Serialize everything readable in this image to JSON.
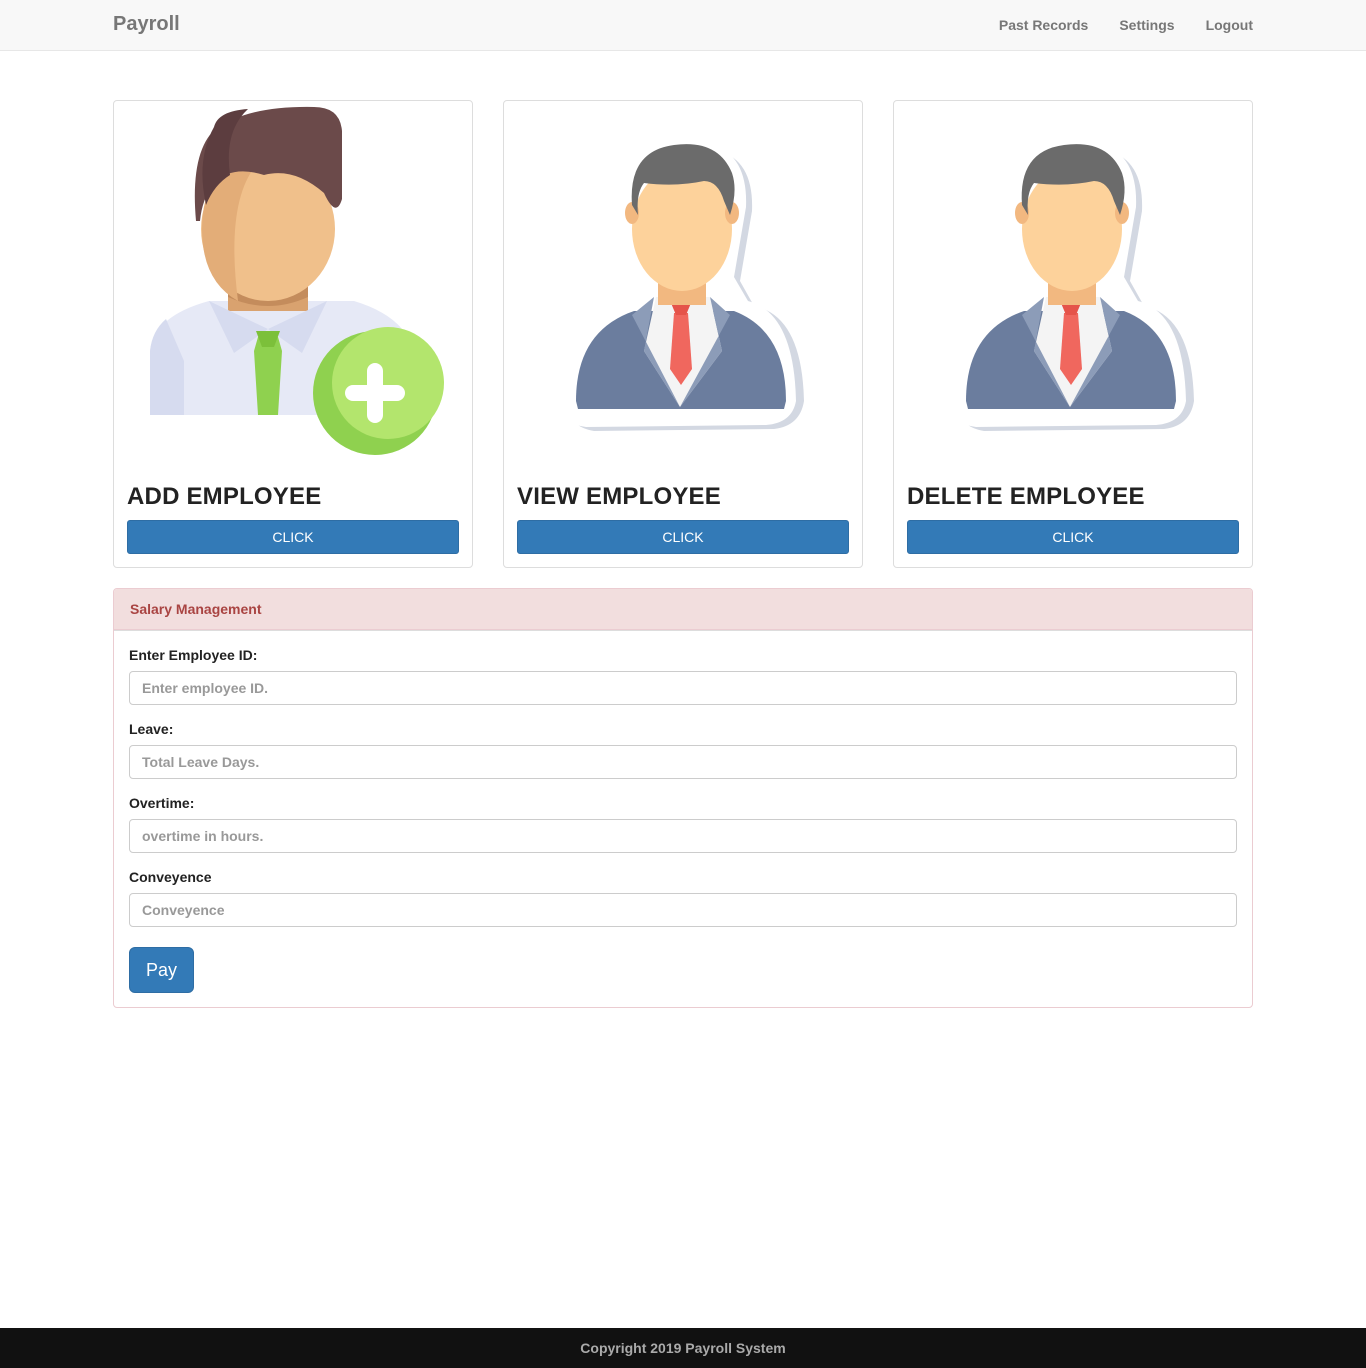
{
  "navbar": {
    "brand": "Payroll",
    "links": [
      "Past Records",
      "Settings",
      "Logout"
    ]
  },
  "cards": [
    {
      "title": "ADD EMPLOYEE",
      "button": "CLICK",
      "icon": "add-user-icon"
    },
    {
      "title": "VIEW EMPLOYEE",
      "button": "CLICK",
      "icon": "employee-icon"
    },
    {
      "title": "DELETE EMPLOYEE",
      "button": "CLICK",
      "icon": "employee-icon"
    }
  ],
  "salary_panel": {
    "heading": "Salary Management",
    "fields": [
      {
        "label": "Enter Employee ID:",
        "placeholder": "Enter employee ID.",
        "value": ""
      },
      {
        "label": "Leave:",
        "placeholder": "Total Leave Days.",
        "value": ""
      },
      {
        "label": "Overtime:",
        "placeholder": "overtime in hours.",
        "value": ""
      },
      {
        "label": "Conveyence",
        "placeholder": "Conveyence",
        "value": ""
      }
    ],
    "submit": "Pay"
  },
  "footer": {
    "text": "Copyright 2019 Payroll System"
  },
  "colors": {
    "primary": "#337ab7",
    "panel_heading_bg": "#f2dede",
    "panel_heading_text": "#a94442",
    "footer_bg": "#111111"
  }
}
